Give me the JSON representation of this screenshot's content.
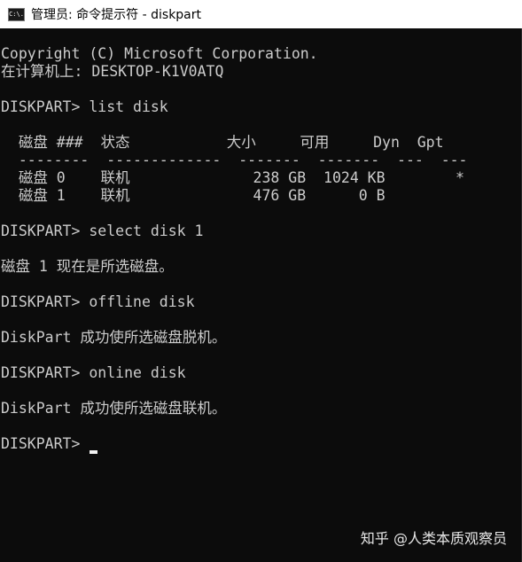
{
  "window": {
    "title": "管理员: 命令提示符 - diskpart",
    "icon_name": "cmd-icon",
    "icon_text": "C:\\."
  },
  "console": {
    "lines": [
      "Copyright (C) Microsoft Corporation.",
      "在计算机上: DESKTOP-K1V0ATQ",
      "",
      "DISKPART> list disk",
      "",
      "  磁盘 ###  状态           大小     可用     Dyn  Gpt",
      "  --------  -------------  -------  -------  ---  ---",
      "  磁盘 0    联机              238 GB  1024 KB        *",
      "  磁盘 1    联机              476 GB      0 B",
      "",
      "DISKPART> select disk 1",
      "",
      "磁盘 1 现在是所选磁盘。",
      "",
      "DISKPART> offline disk",
      "",
      "DiskPart 成功使所选磁盘脱机。",
      "",
      "DISKPART> online disk",
      "",
      "DiskPart 成功使所选磁盘联机。",
      "",
      "DISKPART> "
    ],
    "colors": {
      "background": "#0c0c0c",
      "text": "#cccccc",
      "cursor": "#f2f2f2"
    }
  },
  "watermark": {
    "text": "知乎 @人类本质观察员"
  }
}
